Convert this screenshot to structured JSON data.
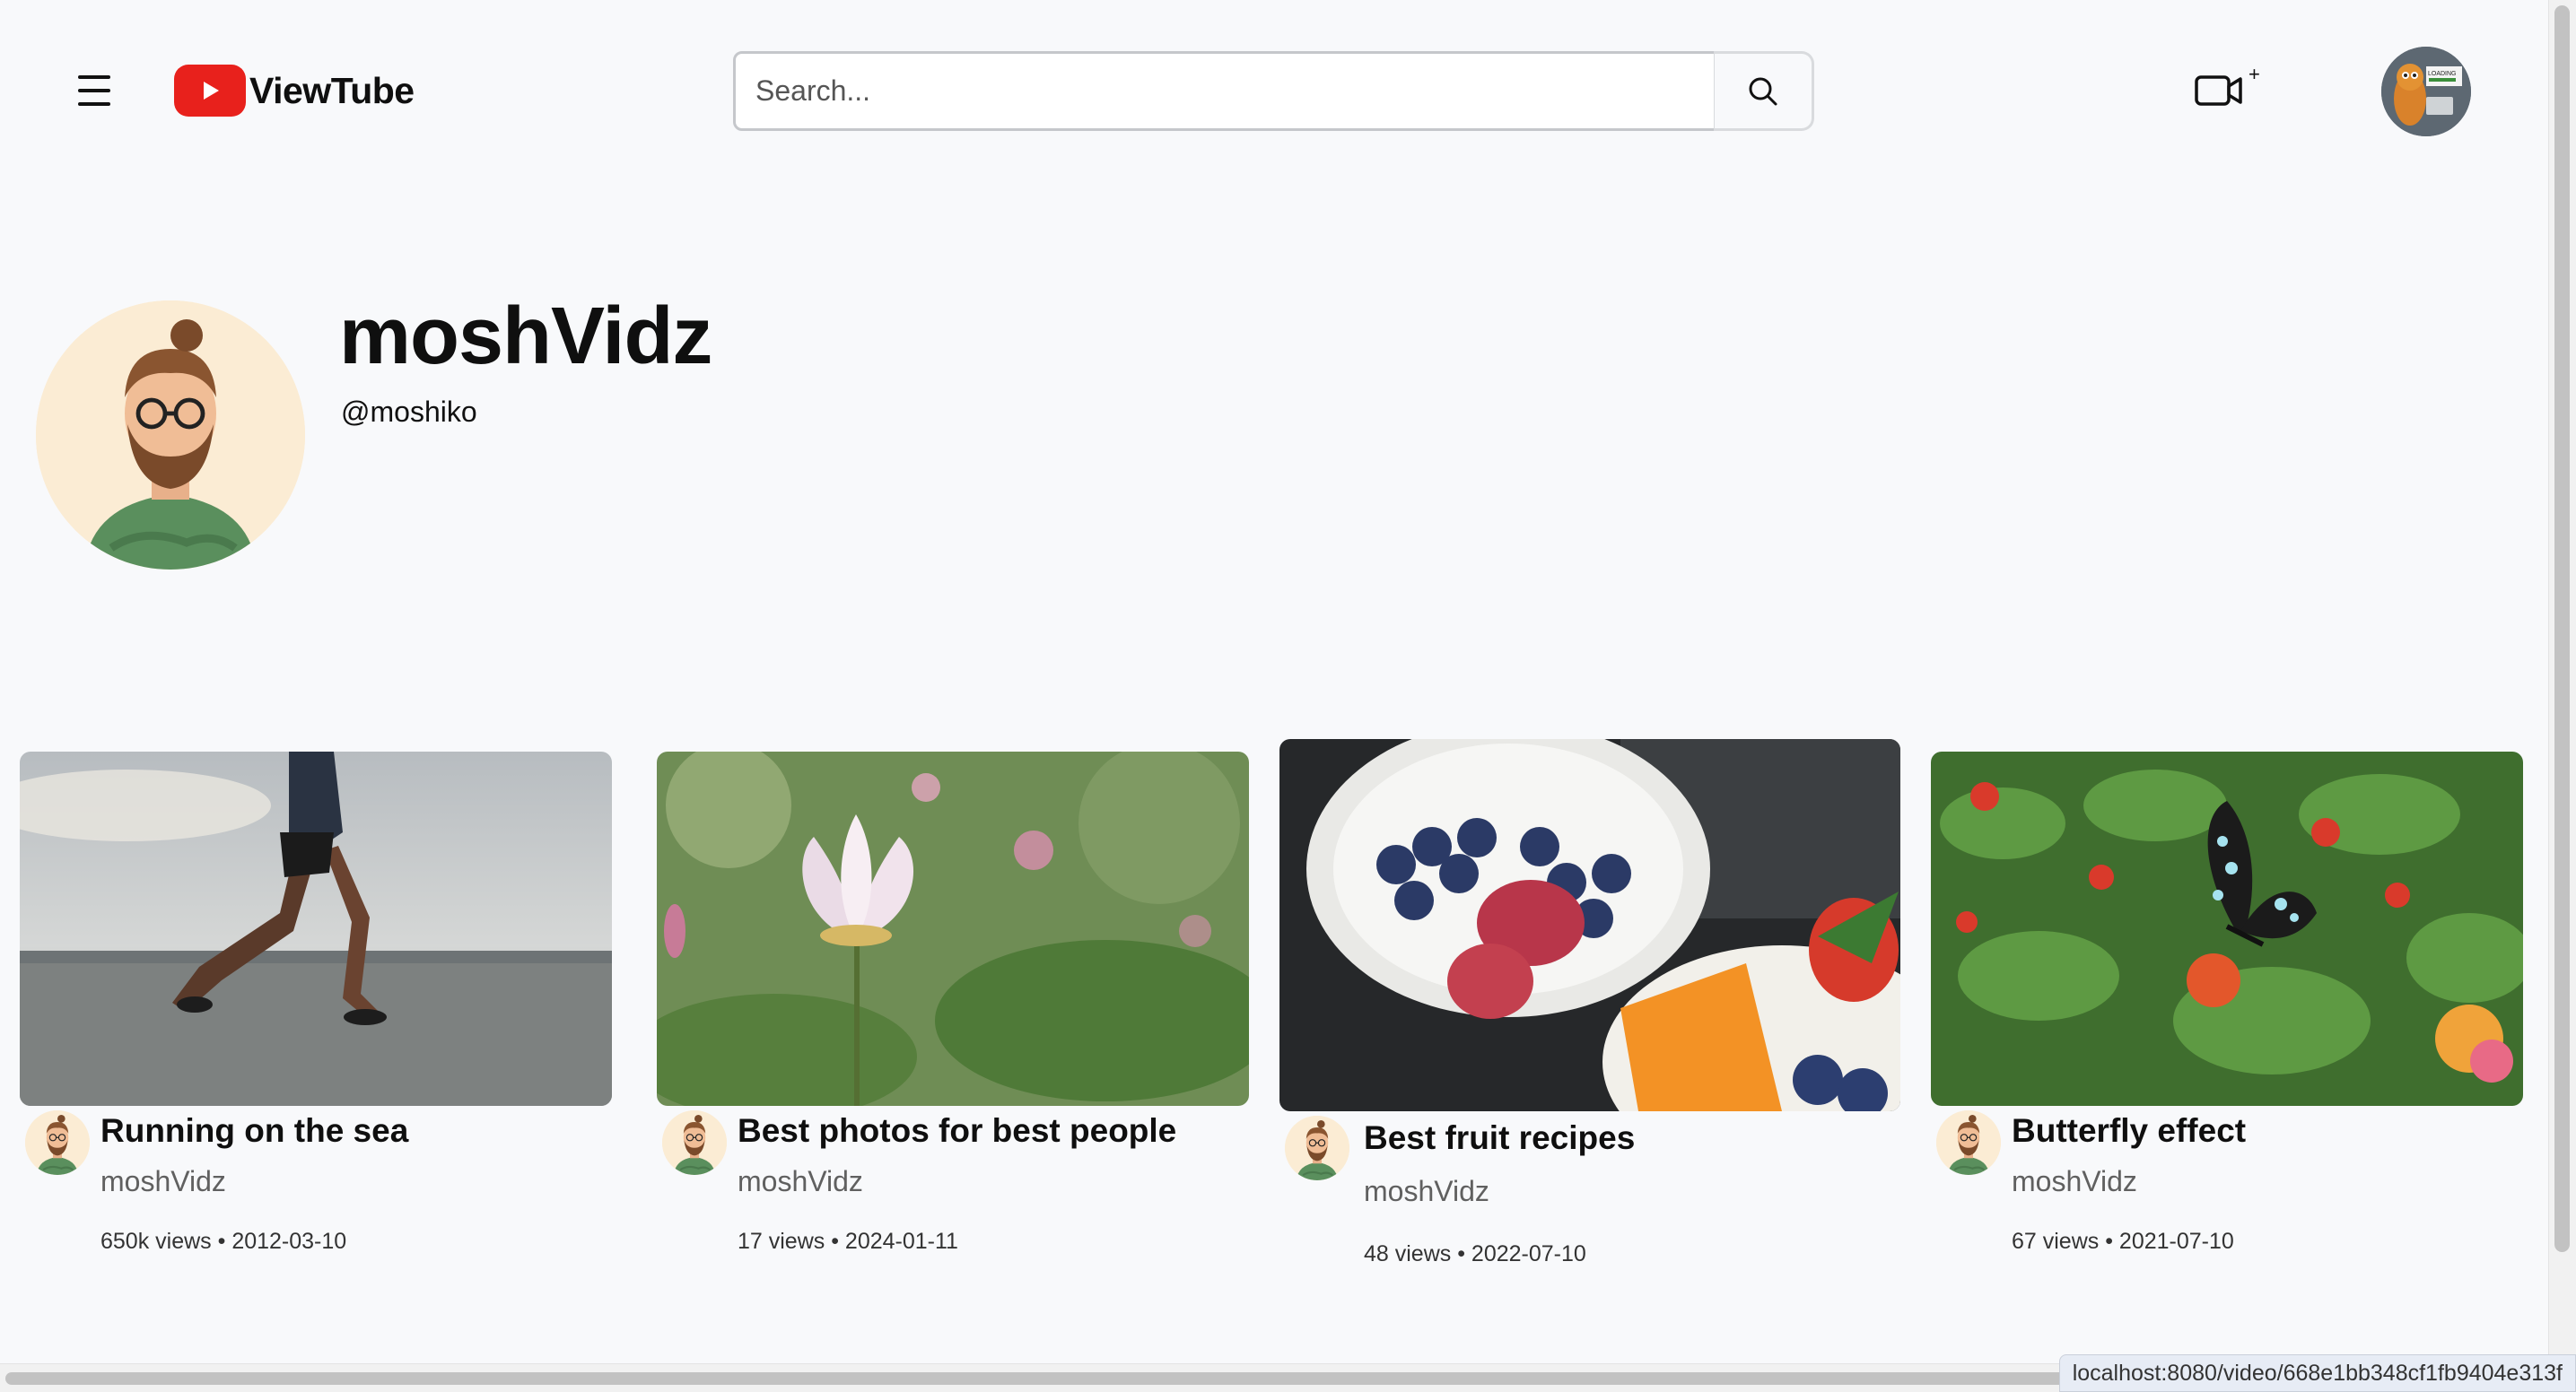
{
  "header": {
    "brand": "ViewTube",
    "search_placeholder": "Search...",
    "upload_plus": "+",
    "header_avatar_text": "LOADING"
  },
  "channel": {
    "name": "moshVidz",
    "handle": "@moshiko"
  },
  "videos": [
    {
      "title": "Running on the sea",
      "channel": "moshVidz",
      "meta": "650k views • 2012-03-10"
    },
    {
      "title": "Best photos for best people",
      "channel": "moshVidz",
      "meta": "17 views • 2024-01-11"
    },
    {
      "title": "Best fruit recipes",
      "channel": "moshVidz",
      "meta": "48 views • 2022-07-10"
    },
    {
      "title": "Butterfly effect",
      "channel": "moshVidz",
      "meta": "67 views • 2021-07-10"
    }
  ],
  "status_bar": {
    "url": "localhost:8080/video/668e1bb348cf1fb9404e313f"
  },
  "colors": {
    "brand_red": "#e8211c",
    "background": "#f8f9fb"
  }
}
